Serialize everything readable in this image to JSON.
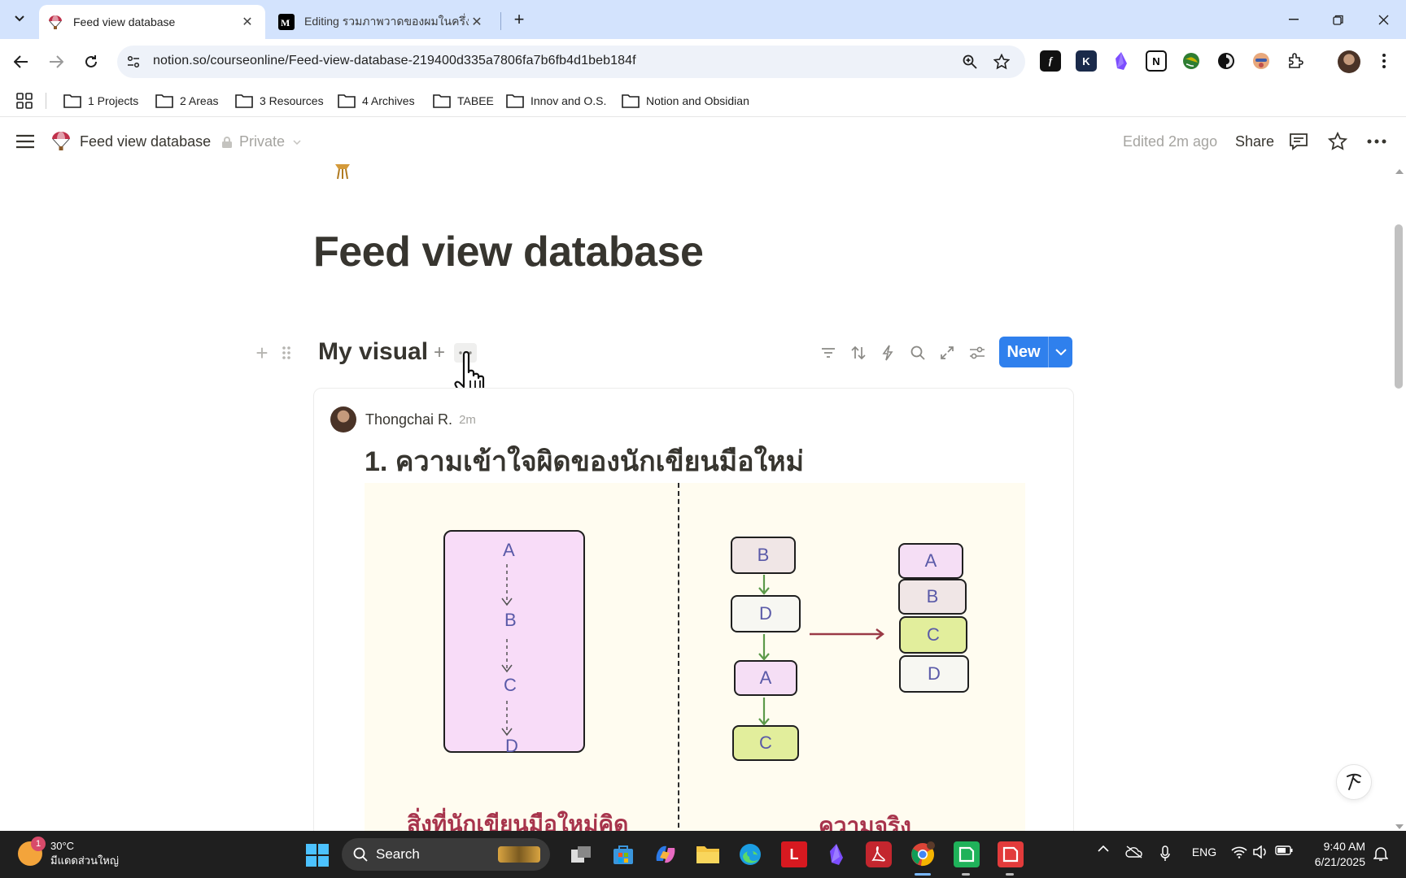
{
  "browser": {
    "tabs": [
      {
        "title": "Feed view database",
        "active": true
      },
      {
        "title": "Editing รวมภาพวาดของผมในครึ่งปีแรก",
        "active": false
      }
    ],
    "url": "notion.so/courseonline/Feed-view-database-219400d335a7806fa7b6fb4d1beb184f",
    "bookmarks": [
      "1 Projects",
      "2 Areas",
      "3 Resources",
      "4 Archives",
      "TABEE",
      "Innov and O.S.",
      "Notion and Obsidian"
    ],
    "colors": {
      "tabstrip": "#d3e3fd",
      "omnibox": "#eef2f9"
    }
  },
  "notion": {
    "breadcrumb_title": "Feed view database",
    "privacy": "Private",
    "edited": "Edited 2m ago",
    "share": "Share",
    "page_title": "Feed view database",
    "database": {
      "title": "My visual",
      "new_label": "New"
    },
    "post": {
      "author": "Thongchai R.",
      "time": "2m",
      "title": "1. ความเข้าใจผิดของนักเขียนมือใหม่",
      "diagram": {
        "left_sequence": [
          "A",
          "B",
          "C",
          "D"
        ],
        "right_flow": [
          "B",
          "D",
          "A",
          "C"
        ],
        "right_stack": [
          "A",
          "B",
          "C",
          "D"
        ],
        "left_caption": "สิ่งที่นักเขียนมือใหม่คิด",
        "right_caption": "ความจริง"
      }
    },
    "colors": {
      "new_button": "#2f80ed",
      "caption": "#a7344c"
    }
  },
  "taskbar": {
    "weather_temp": "30°C",
    "weather_desc": "มีแดดส่วนใหญ่",
    "weather_badge": "1",
    "search_label": "Search",
    "language": "ENG",
    "time": "9:40 AM",
    "date": "6/21/2025"
  }
}
